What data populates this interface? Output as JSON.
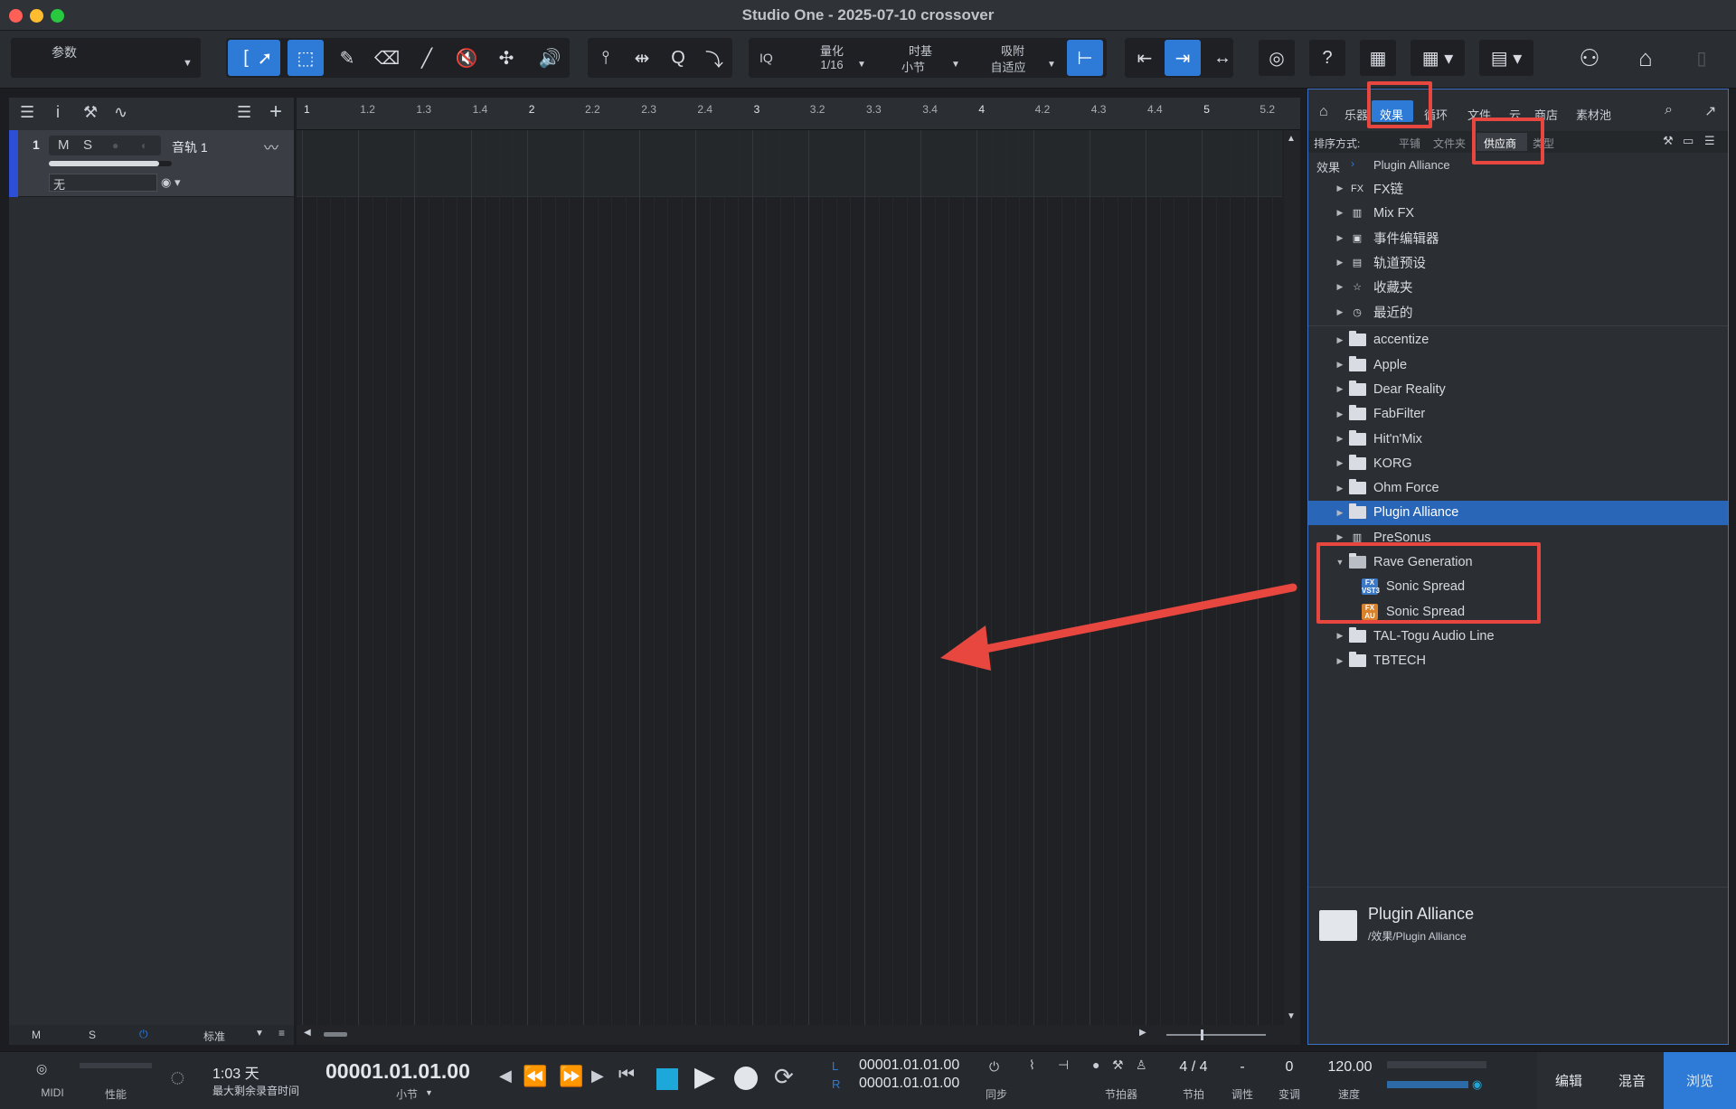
{
  "window": {
    "title": "Studio One - 2025-07-10 crossover"
  },
  "toolbar": {
    "param_label": "参数",
    "quantize": {
      "label": "量化",
      "value": "1/16"
    },
    "timebase": {
      "label": "时基",
      "value": "小节"
    },
    "snap": {
      "label": "吸附",
      "value": "自适应"
    },
    "iq_label": "IQ",
    "help": "?"
  },
  "track": {
    "number": "1",
    "mute": "M",
    "solo": "S",
    "name": "音轨 1",
    "input": "无"
  },
  "ruler": {
    "ticks": [
      "1",
      "1.2",
      "1.3",
      "1.4",
      "2",
      "2.2",
      "2.3",
      "2.4",
      "3",
      "3.2",
      "3.3",
      "3.4",
      "4",
      "4.2",
      "4.3",
      "4.4",
      "5",
      "5.2"
    ]
  },
  "track_footer": {
    "m": "M",
    "s": "S",
    "mode": "标准"
  },
  "browser": {
    "tabs": [
      "乐器",
      "效果",
      "循环",
      "文件",
      "云",
      "商店",
      "素材池"
    ],
    "sort_label": "排序方式:",
    "sort_options": [
      "平铺",
      "文件夹",
      "供应商",
      "类型"
    ],
    "breadcrumb": {
      "root": "效果",
      "current": "Plugin Alliance"
    },
    "items": [
      {
        "label": "FX链",
        "icon": "fx-chain-icon"
      },
      {
        "label": "Mix FX",
        "icon": "mixfx-icon"
      },
      {
        "label": "事件编辑器",
        "icon": "event-editor-icon"
      },
      {
        "label": "轨道预设",
        "icon": "track-preset-icon"
      },
      {
        "label": "收藏夹",
        "icon": "star-icon"
      },
      {
        "label": "最近的",
        "icon": "clock-icon"
      }
    ],
    "vendors": [
      "accentize",
      "Apple",
      "Dear Reality",
      "FabFilter",
      "Hit'n'Mix",
      "KORG",
      "Ohm Force",
      "Plugin Alliance",
      "PreSonus"
    ],
    "expanded_vendor": "Rave Generation",
    "expanded_children": [
      {
        "label": "Sonic Spread",
        "badge": "VST3"
      },
      {
        "label": "Sonic Spread",
        "badge": "AU"
      }
    ],
    "vendors_after": [
      "TAL-Togu Audio Line",
      "TBTECH"
    ],
    "info": {
      "name": "Plugin Alliance",
      "path": "/效果/Plugin Alliance"
    }
  },
  "transport": {
    "midi": "MIDI",
    "perf": "性能",
    "record_time": "1:03 天",
    "record_time_label": "最大剩余录音时间",
    "position": "00001.01.01.00",
    "position_unit": "小节",
    "loop_l": "00001.01.01.00",
    "loop_r": "00001.01.01.00",
    "l_label": "L",
    "r_label": "R",
    "sync_label": "同步",
    "metronome_label": "节拍器",
    "time_sig": "4 / 4",
    "time_sig_label": "节拍",
    "key": "-",
    "key_label": "调性",
    "transpose": "0",
    "transpose_label": "变调",
    "tempo": "120.00",
    "tempo_label": "速度",
    "edit": "编辑",
    "mix": "混音",
    "browse": "浏览"
  },
  "colors": {
    "accent": "#2d7bd6",
    "highlight_row": "#2a66b8",
    "annotation": "#e8473f"
  }
}
